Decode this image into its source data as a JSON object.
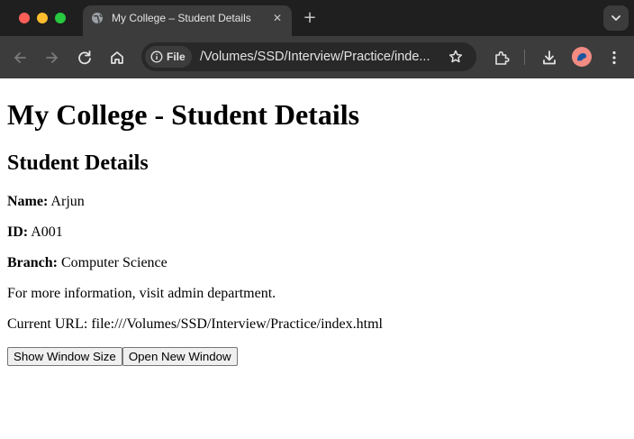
{
  "browser": {
    "tab": {
      "title": "My College – Student Details",
      "favicon": "globe-icon"
    },
    "address_bar": {
      "chip_label": "File",
      "url": "/Volumes/SSD/Interview/Practice/inde..."
    },
    "icons": [
      "back-icon",
      "forward-icon",
      "reload-icon",
      "home-icon",
      "info-icon",
      "star-icon",
      "extensions-icon",
      "download-icon",
      "profile-avatar",
      "menu-icon",
      "tab-search-icon",
      "new-tab-icon",
      "close-icon"
    ],
    "colors": {
      "tabstrip": "#1f1f1f",
      "toolbar": "#3c3c3c",
      "omnibox": "#282828",
      "avatar": "#f28b82",
      "close_light": "#ff5f57",
      "minimize_light": "#febc2e",
      "maximize_light": "#28c840"
    }
  },
  "page": {
    "heading": "My College - Student Details",
    "subheading": "Student Details",
    "fields": [
      {
        "label": "Name:",
        "value": " Arjun"
      },
      {
        "label": "ID:",
        "value": " A001"
      },
      {
        "label": "Branch:",
        "value": " Computer Science"
      }
    ],
    "info_text": "For more information, visit admin department.",
    "current_url_text": "Current URL: file:///Volumes/SSD/Interview/Practice/index.html",
    "buttons": {
      "show_size": "Show Window Size",
      "open_window": "Open New Window"
    }
  }
}
